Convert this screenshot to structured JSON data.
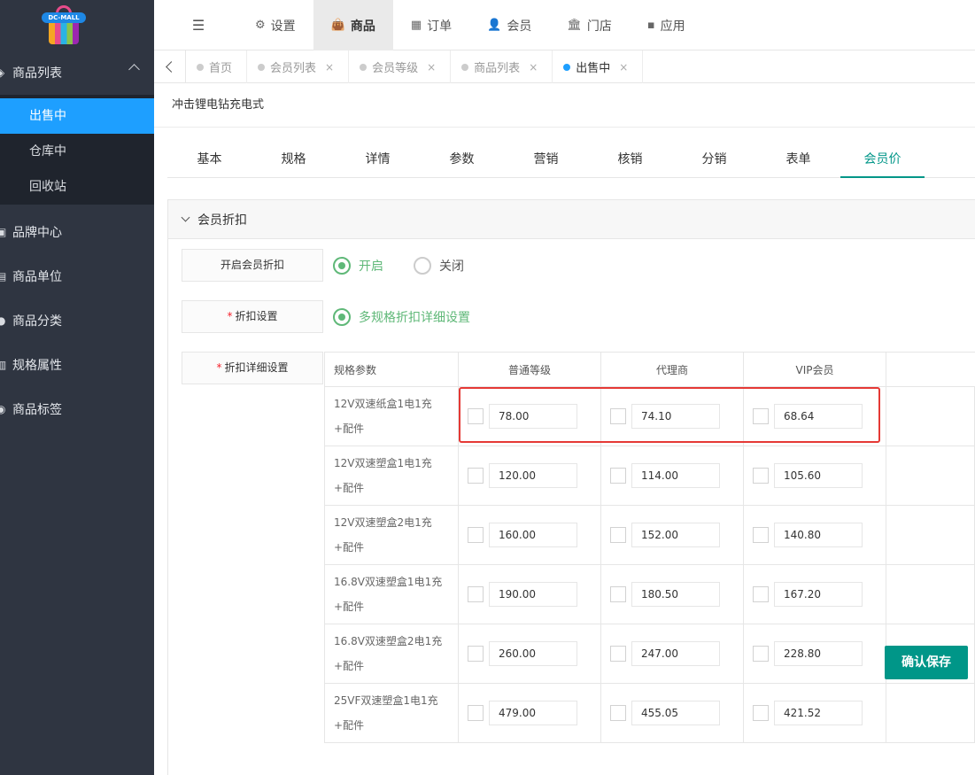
{
  "sidebar": {
    "logo_text": "DC-MALL",
    "group_main": {
      "label": "商品列表",
      "icon": "cube-icon"
    },
    "sub_items": [
      {
        "label": "出售中",
        "active": true
      },
      {
        "label": "仓库中"
      },
      {
        "label": "回收站"
      }
    ],
    "groups": [
      {
        "label": "品牌中心",
        "icon": "briefcase-icon"
      },
      {
        "label": "商品单位",
        "icon": "unit-icon"
      },
      {
        "label": "商品分类",
        "icon": "category-icon"
      },
      {
        "label": "规格属性",
        "icon": "spec-icon"
      },
      {
        "label": "商品标签",
        "icon": "tag-icon"
      }
    ]
  },
  "topnav": {
    "items": [
      {
        "label": "设置",
        "icon": "gears-icon",
        "glyph": "⚙"
      },
      {
        "label": "商品",
        "icon": "shopping-bag-icon",
        "glyph": "👜",
        "active": true
      },
      {
        "label": "订单",
        "icon": "table-icon",
        "glyph": "▦"
      },
      {
        "label": "会员",
        "icon": "user-icon",
        "glyph": "👤"
      },
      {
        "label": "门店",
        "icon": "bank-icon",
        "glyph": "🏛"
      },
      {
        "label": "应用",
        "icon": "apps-icon",
        "glyph": "▪"
      }
    ]
  },
  "pagetabs": [
    {
      "label": "首页",
      "closable": false
    },
    {
      "label": "会员列表",
      "closable": true
    },
    {
      "label": "会员等级",
      "closable": true
    },
    {
      "label": "商品列表",
      "closable": true
    },
    {
      "label": "出售中",
      "closable": true,
      "active": true
    }
  ],
  "product": {
    "title": "冲击锂电钻充电式"
  },
  "content_tabs": [
    "基本",
    "规格",
    "详情",
    "参数",
    "营销",
    "核销",
    "分销",
    "表单",
    "会员价"
  ],
  "active_content_tab": "会员价",
  "panel": {
    "title": "会员折扣",
    "enable_label": "开启会员折扣",
    "enable_on": "开启",
    "enable_off": "关闭",
    "discount_label": "折扣设置",
    "discount_option": "多规格折扣详细设置",
    "detail_label": "折扣详细设置"
  },
  "table": {
    "headers": [
      "规格参数",
      "普通等级",
      "代理商",
      "VIP会员"
    ],
    "rows": [
      {
        "spec": "12V双速纸盒1电1充+配件",
        "values": [
          "78.00",
          "74.10",
          "68.64"
        ]
      },
      {
        "spec": "12V双速塑盒1电1充+配件",
        "values": [
          "120.00",
          "114.00",
          "105.60"
        ]
      },
      {
        "spec": "12V双速塑盒2电1充+配件",
        "values": [
          "160.00",
          "152.00",
          "140.80"
        ]
      },
      {
        "spec": "16.8V双速塑盒1电1充+配件",
        "values": [
          "190.00",
          "180.50",
          "167.20"
        ]
      },
      {
        "spec": "16.8V双速塑盒2电1充+配件",
        "values": [
          "260.00",
          "247.00",
          "228.80"
        ]
      },
      {
        "spec": "25VF双速塑盒1电1充+配件",
        "values": [
          "479.00",
          "455.05",
          "421.52"
        ]
      }
    ]
  },
  "save_button": "确认保存",
  "close_glyph": "×",
  "menu_glyph": "☰",
  "colors": {
    "accent": "#009688",
    "active_blue": "#1e9fff",
    "radio_green": "#5fb878",
    "highlight_red": "#e53935"
  }
}
